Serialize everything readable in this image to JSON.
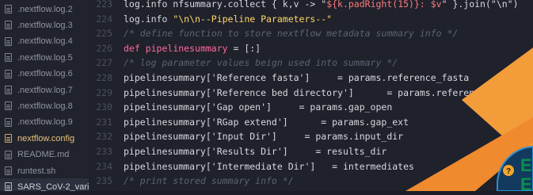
{
  "sidebar": {
    "items": [
      {
        "label": ".nextflow.log.2",
        "icon": "file-icon"
      },
      {
        "label": ".nextflow.log.3",
        "icon": "file-icon"
      },
      {
        "label": ".nextflow.log.4",
        "icon": "file-icon"
      },
      {
        "label": ".nextflow.log.5",
        "icon": "file-icon"
      },
      {
        "label": ".nextflow.log.6",
        "icon": "file-icon"
      },
      {
        "label": ".nextflow.log.7",
        "icon": "file-icon"
      },
      {
        "label": ".nextflow.log.8",
        "icon": "file-icon"
      },
      {
        "label": ".nextflow.log.9",
        "icon": "file-icon"
      },
      {
        "label": "nextflow.config",
        "icon": "config-file-icon"
      },
      {
        "label": "README.md",
        "icon": "markdown-file-icon"
      },
      {
        "label": "runtest.sh",
        "icon": "file-icon"
      },
      {
        "label": "SARS_CoV-2_vari",
        "icon": "file-icon"
      }
    ]
  },
  "editor": {
    "lines": [
      {
        "num": "223",
        "parts": [
          {
            "t": "log.info nfsummary.collect { k,v -> \"",
            "c": "plain"
          },
          {
            "t": "${k.padRight(15)}: $v",
            "c": "interp"
          },
          {
            "t": "\" }.join(\"\\n\")",
            "c": "plain"
          }
        ]
      },
      {
        "num": "224",
        "parts": [
          {
            "t": "log.info ",
            "c": "plain"
          },
          {
            "t": "\"\\n\\n--Pipeline Parameters--\"",
            "c": "string"
          }
        ]
      },
      {
        "num": "225",
        "parts": [
          {
            "t": "/* define function to store nextflow metadata summary info */",
            "c": "comment"
          }
        ]
      },
      {
        "num": "226",
        "parts": [
          {
            "t": "def ",
            "c": "keyword"
          },
          {
            "t": "pipelinesummary",
            "c": "func"
          },
          {
            "t": " = [:]",
            "c": "plain"
          }
        ]
      },
      {
        "num": "227",
        "parts": [
          {
            "t": "/* log parameter values beign used into summary */",
            "c": "comment"
          }
        ]
      },
      {
        "num": "228",
        "parts": [
          {
            "t": "pipelinesummary['Reference fasta']     = params.reference_fasta",
            "c": "plain"
          }
        ]
      },
      {
        "num": "229",
        "parts": [
          {
            "t": "pipelinesummary['Reference bed directory']      = params.referen",
            "c": "plain"
          }
        ]
      },
      {
        "num": "230",
        "parts": [
          {
            "t": "pipelinesummary['Gap open']     = params.gap_open",
            "c": "plain"
          }
        ]
      },
      {
        "num": "231",
        "parts": [
          {
            "t": "pipelinesummary['RGap extend']      = params.gap_ext",
            "c": "plain"
          }
        ]
      },
      {
        "num": "232",
        "parts": [
          {
            "t": "pipelinesummary['Input Dir']     = params.input_dir",
            "c": "plain"
          }
        ]
      },
      {
        "num": "233",
        "parts": [
          {
            "t": "pipelinesummary['Results Dir']     = results_dir",
            "c": "plain"
          }
        ]
      },
      {
        "num": "234",
        "parts": [
          {
            "t": "pipelinesummary['Intermediate Dir']   = intermediates",
            "c": "plain"
          }
        ]
      },
      {
        "num": "235",
        "parts": [
          {
            "t": "/* print stored summary info */",
            "c": "comment"
          }
        ]
      }
    ]
  },
  "decor": {
    "badge_icon": "question-mark-icon",
    "badge_glyph": "?",
    "badge_letters": [
      "E",
      "E"
    ]
  },
  "colors": {
    "editor_bg": "#1f212b",
    "sidebar_bg": "#21232c",
    "keyword": "#ff6b9f",
    "string": "#ffd866",
    "comment": "#5c6370",
    "orange_accent": "#f39c3a",
    "badge_green": "#0b8f4f"
  }
}
